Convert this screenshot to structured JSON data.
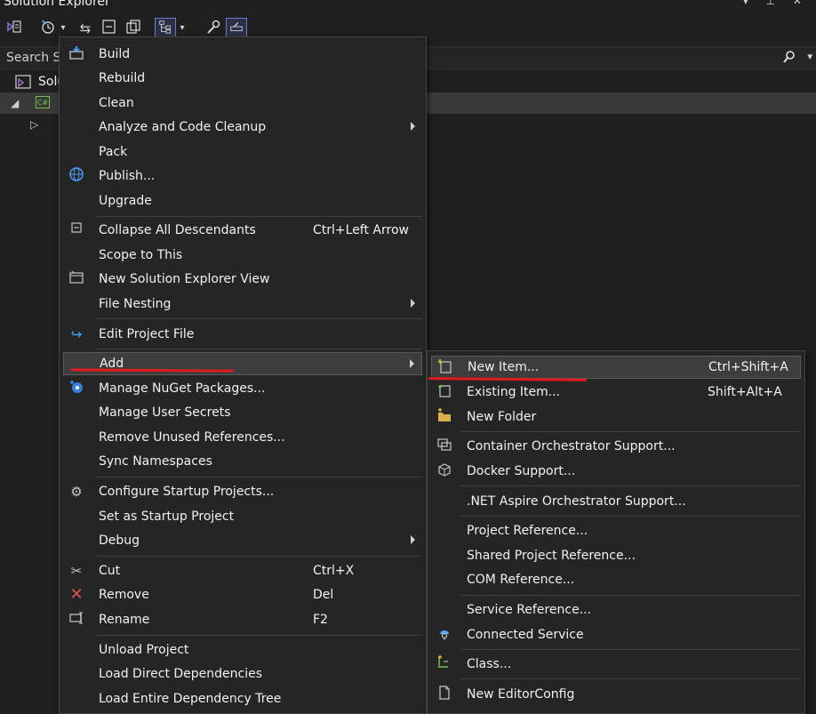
{
  "window": {
    "title": "Solution Explorer",
    "controls": "▾ ⊥ ✕"
  },
  "toolbar": {
    "icons": [
      "vs-home-icon",
      "history-icon",
      "sync-icon",
      "collapse-icon",
      "switch-views-icon",
      "filter-icon",
      "properties-icon",
      "preview-icon"
    ]
  },
  "search": {
    "placeholder": "Search So",
    "icon": "search-icon"
  },
  "tree": {
    "solution_label": "Solu",
    "project_badge": "C#"
  },
  "context_menu": {
    "items": [
      {
        "label": "Build",
        "icon": "build-icon"
      },
      {
        "label": "Rebuild"
      },
      {
        "label": "Clean"
      },
      {
        "label": "Analyze and Code Cleanup",
        "submenu": true
      },
      {
        "label": "Pack"
      },
      {
        "label": "Publish...",
        "icon": "globe-icon"
      },
      {
        "label": "Upgrade"
      },
      {
        "label": "Collapse All Descendants",
        "shortcut": "Ctrl+Left Arrow",
        "icon": "collapse-icon"
      },
      {
        "label": "Scope to This"
      },
      {
        "label": "New Solution Explorer View",
        "icon": "new-window-icon"
      },
      {
        "label": "File Nesting",
        "submenu": true
      },
      {
        "label": "Edit Project File",
        "icon": "edit-arrow-icon"
      },
      {
        "label": "Add",
        "submenu": true,
        "highlighted": true
      },
      {
        "label": "Manage NuGet Packages...",
        "icon": "nuget-icon"
      },
      {
        "label": "Manage User Secrets"
      },
      {
        "label": "Remove Unused References..."
      },
      {
        "label": "Sync Namespaces"
      },
      {
        "label": "Configure Startup Projects...",
        "icon": "gear-icon"
      },
      {
        "label": "Set as Startup Project"
      },
      {
        "label": "Debug",
        "submenu": true
      },
      {
        "label": "Cut",
        "shortcut": "Ctrl+X",
        "icon": "scissors-icon"
      },
      {
        "label": "Remove",
        "shortcut": "Del",
        "icon": "remove-x-icon"
      },
      {
        "label": "Rename",
        "shortcut": "F2",
        "icon": "rename-icon"
      },
      {
        "label": "Unload Project"
      },
      {
        "label": "Load Direct Dependencies"
      },
      {
        "label": "Load Entire Dependency Tree"
      }
    ]
  },
  "add_submenu": {
    "items": [
      {
        "label": "New Item...",
        "shortcut": "Ctrl+Shift+A",
        "icon": "new-item-icon",
        "highlighted": true
      },
      {
        "label": "Existing Item...",
        "shortcut": "Shift+Alt+A",
        "icon": "existing-item-icon"
      },
      {
        "label": "New Folder",
        "icon": "new-folder-icon"
      },
      {
        "label": "Container Orchestrator Support...",
        "icon": "container-icon"
      },
      {
        "label": "Docker Support...",
        "icon": "docker-icon"
      },
      {
        "label": ".NET Aspire Orchestrator Support..."
      },
      {
        "label": "Project Reference..."
      },
      {
        "label": "Shared Project Reference..."
      },
      {
        "label": "COM Reference..."
      },
      {
        "label": "Service Reference..."
      },
      {
        "label": "Connected Service",
        "icon": "connected-service-icon"
      },
      {
        "label": "Class...",
        "icon": "class-icon"
      },
      {
        "label": "New EditorConfig",
        "icon": "document-icon"
      }
    ]
  },
  "colors": {
    "background": "#1f1f1f",
    "menu": "#252526",
    "highlight": "#3d3d3d",
    "annotation": "#e01b1b",
    "accent": "#6c7bd1"
  }
}
